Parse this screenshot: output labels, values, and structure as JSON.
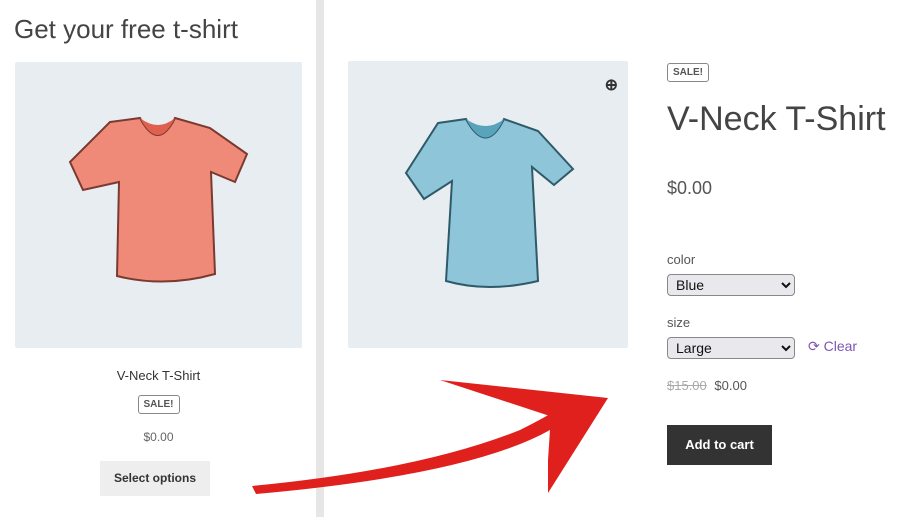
{
  "left": {
    "heading": "Get your free t-shirt",
    "product_name": "V-Neck T-Shirt",
    "badge": "SALE!",
    "price": "$0.00",
    "button": "Select options"
  },
  "product": {
    "badge": "SALE!",
    "title": "V-Neck T-Shirt",
    "price": "$0.00",
    "color_label": "color",
    "color_value": "Blue",
    "size_label": "size",
    "size_value": "Large",
    "clear": "Clear",
    "old_price": "$15.00",
    "new_price": "$0.00",
    "add_to_cart": "Add to cart"
  },
  "colors": {
    "accent": "#7f54b3",
    "arrow": "#e0201c",
    "shirt_left": "#f08a78",
    "shirt_right": "#8ec5d8"
  }
}
